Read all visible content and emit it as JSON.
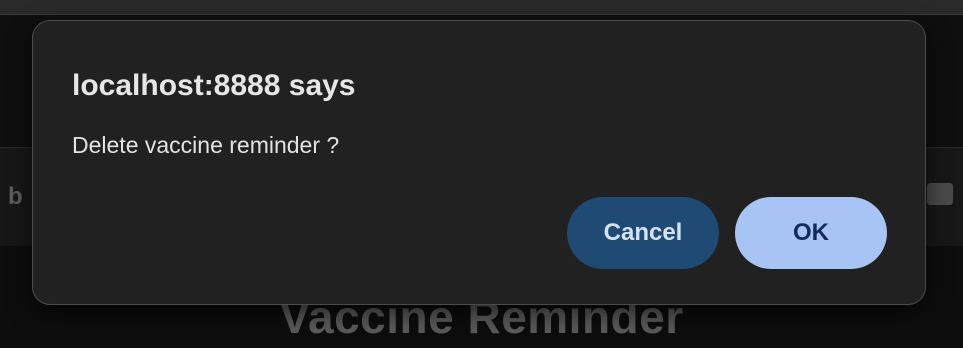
{
  "background": {
    "page_title": "Vaccine Reminder"
  },
  "dialog": {
    "title": "localhost:8888 says",
    "message": "Delete vaccine reminder ?",
    "cancel_label": "Cancel",
    "ok_label": "OK"
  },
  "colors": {
    "dialog_bg": "#212121",
    "cancel_bg": "#1f4a73",
    "ok_bg": "#a8c4f4"
  }
}
